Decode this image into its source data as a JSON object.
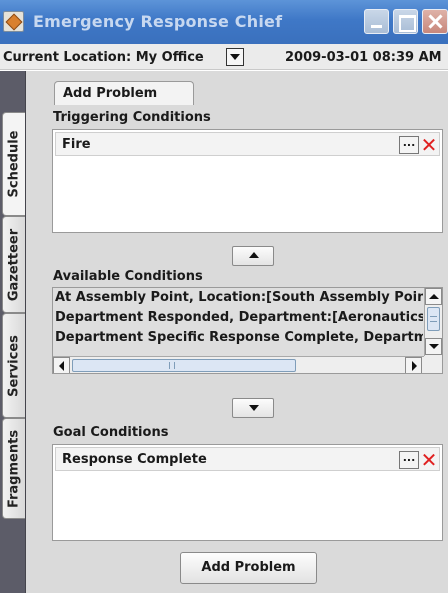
{
  "window": {
    "title": "Emergency Response Chief"
  },
  "topbar": {
    "location_label": "Current Location: My Office",
    "datetime": "2009-03-01 08:39 AM"
  },
  "side_tabs": [
    "Schedule",
    "Gazetteer",
    "Services",
    "Fragments"
  ],
  "panel": {
    "tab_label": "Add Problem",
    "triggering": {
      "label": "Triggering Conditions",
      "items": [
        "Fire"
      ]
    },
    "available": {
      "label": "Available Conditions",
      "items": [
        "At Assembly Point, Location:[South Assembly Point,",
        "Department Responded, Department:[Aeronautics,",
        "Department Specific Response Complete, Departme"
      ]
    },
    "goal": {
      "label": "Goal Conditions",
      "items": [
        "Response Complete"
      ]
    },
    "add_button_label": "Add Problem",
    "edit_button_label": "...",
    "remove_glyph": "✕"
  },
  "colors": {
    "titlebar": "#3f78c7",
    "tabstrip": "#5c5c68",
    "remove_red": "#e02020"
  }
}
